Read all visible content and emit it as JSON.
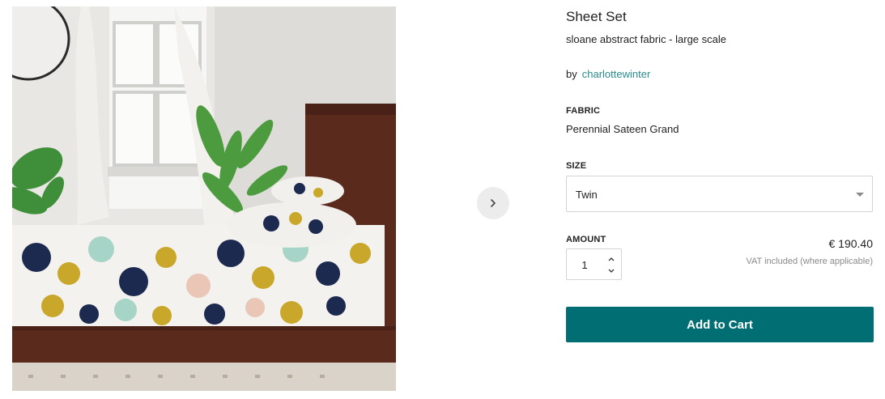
{
  "product": {
    "title": "Sheet Set",
    "subtitle": "sloane abstract fabric - large scale",
    "by_label": "by",
    "designer": "charlottewinter"
  },
  "fabric": {
    "label": "FABRIC",
    "value": "Perennial Sateen Grand"
  },
  "size": {
    "label": "SIZE",
    "selected": "Twin"
  },
  "amount": {
    "label": "AMOUNT",
    "quantity": "1"
  },
  "pricing": {
    "price": "€ 190.40",
    "vat_note": "VAT included (where applicable)"
  },
  "actions": {
    "add_to_cart": "Add to Cart"
  },
  "gallery": {
    "next_icon": "chevron-right-icon"
  },
  "colors": {
    "accent": "#006e73",
    "link": "#2b8a8d"
  }
}
